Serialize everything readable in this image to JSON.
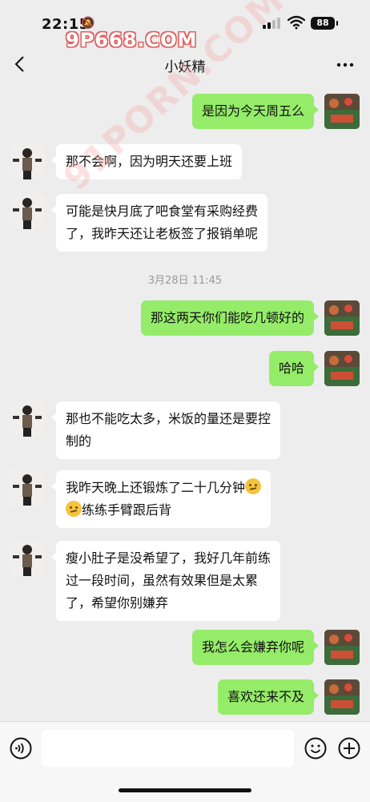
{
  "status_bar": {
    "time": "22:15",
    "battery": "88"
  },
  "watermark": "9P668.COM",
  "watermark_diagonal": "91PORN.COM",
  "nav": {
    "title": "小妖精"
  },
  "timestamp": "3月28日 11:45",
  "messages": [
    {
      "side": "out",
      "text": "是因为今天周五么"
    },
    {
      "side": "in",
      "text": "那不会啊，因为明天还要上班"
    },
    {
      "side": "in",
      "line1": "可能是快月底了吧食堂有采购经费",
      "line2": "了，我昨天还让老板签了报销单呢"
    },
    {
      "side": "out",
      "text": "那这两天你们能吃几顿好的"
    },
    {
      "side": "out",
      "text": "哈哈"
    },
    {
      "side": "in",
      "line1": "那也不能吃太多，米饭的量还是要控",
      "line2": "制的"
    },
    {
      "side": "in",
      "line1": "我昨天晚上还锻炼了二十几分钟",
      "line2": "练练手臂跟后背"
    },
    {
      "side": "in",
      "line1": "瘦小肚子是没希望了，我好几年前练",
      "line2": "过一段时间，虽然有效果但是太累",
      "line3": "了，希望你别嫌弃"
    },
    {
      "side": "out",
      "text": "我怎么会嫌弃你呢"
    },
    {
      "side": "out",
      "text": "喜欢还来不及"
    }
  ],
  "icons": {
    "back": "chevron-left-icon",
    "more": "more-dots-icon",
    "voice": "voice-icon",
    "emoji": "emoji-icon",
    "plus": "plus-icon",
    "thinking_emoji": "thinking-face-icon"
  },
  "colors": {
    "outgoing_bubble": "#95ec69",
    "incoming_bubble": "#ffffff",
    "background": "#ededed"
  }
}
